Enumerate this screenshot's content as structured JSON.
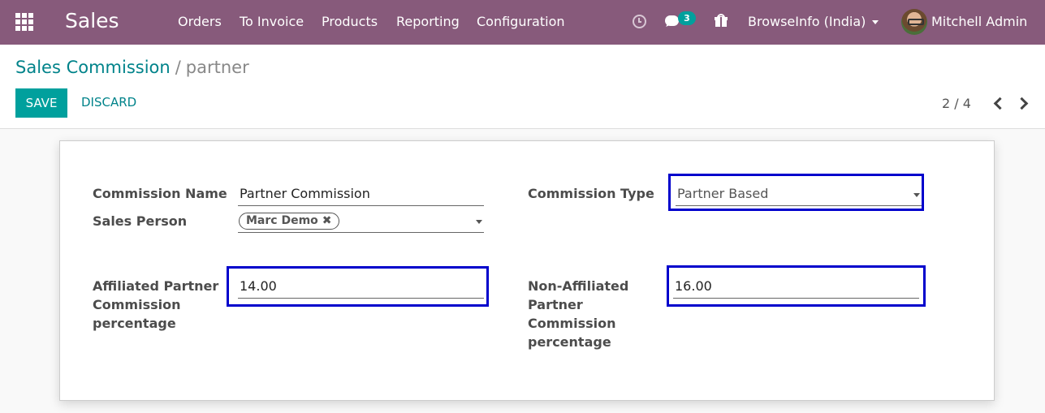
{
  "navbar": {
    "app_name": "Sales",
    "menu": [
      "Orders",
      "To Invoice",
      "Products",
      "Reporting",
      "Configuration"
    ],
    "chat_count": "3",
    "company": "BrowseInfo (India)",
    "user": "Mitchell Admin"
  },
  "control_panel": {
    "breadcrumb_parent": "Sales Commission",
    "breadcrumb_separator": "/",
    "breadcrumb_current": "partner",
    "save_label": "SAVE",
    "discard_label": "DISCARD",
    "pager": "2 / 4"
  },
  "form": {
    "commission_name_label": "Commission Name",
    "commission_name_value": "Partner Commission",
    "sales_person_label": "Sales Person",
    "sales_person_tag": "Marc Demo",
    "commission_type_label": "Commission Type",
    "commission_type_value": "Partner Based",
    "affiliated_label_1": "Affiliated Partner",
    "affiliated_label_2": "Commission",
    "affiliated_label_3": "percentage",
    "affiliated_value": "14.00",
    "non_affiliated_label_1": "Non-Affiliated",
    "non_affiliated_label_2": "Partner",
    "non_affiliated_label_3": "Commission",
    "non_affiliated_label_4": "percentage",
    "non_affiliated_value": "16.00"
  },
  "colors": {
    "navbar": "#875a7b",
    "accent": "#00a09d",
    "highlight_box": "#0000cc"
  },
  "icons": [
    "apps-grid-icon",
    "clock-icon",
    "chat-icon",
    "gift-icon",
    "caret-down-icon",
    "chevron-left-icon",
    "chevron-right-icon",
    "close-icon"
  ]
}
